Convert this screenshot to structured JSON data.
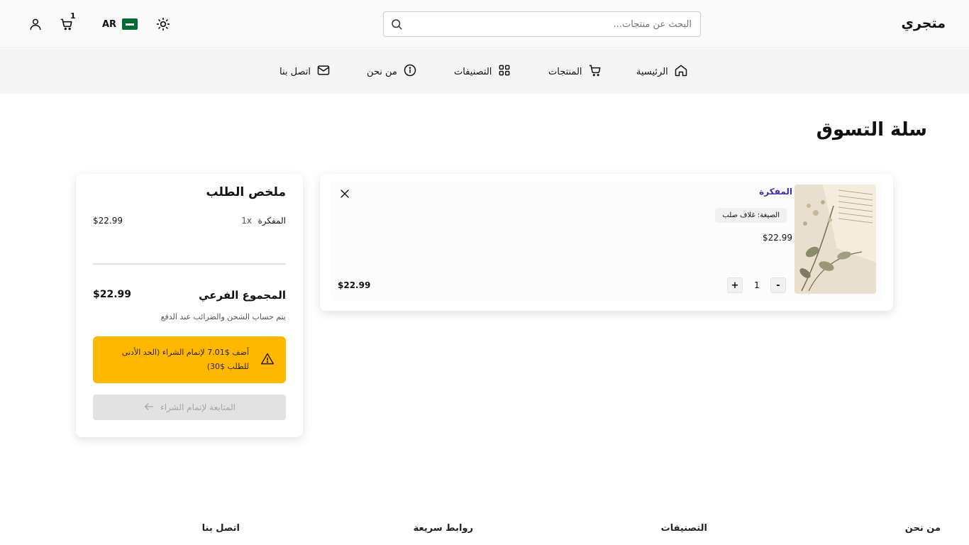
{
  "header": {
    "brand": "متجري",
    "search_placeholder": "البحث عن منتجات...",
    "lang": "AR",
    "cart_count": "1",
    "icons": {
      "search": "search-icon",
      "theme": "sun-icon",
      "cart": "cart-icon",
      "user": "user-icon",
      "flag": "saudi-flag-icon"
    }
  },
  "nav": {
    "home": "الرئيسية",
    "products": "المنتجات",
    "categories": "التصنيفات",
    "about": "من نحن",
    "contact": "اتصل بنا"
  },
  "page": {
    "title": "سلة التسوق"
  },
  "cart": {
    "items": [
      {
        "name": "المفكرة",
        "variant": "الصيغة: غلاف صلب",
        "unit_price": "$22.99",
        "quantity": "1",
        "line_total": "$22.99",
        "minus_label": "-",
        "plus_label": "+"
      }
    ]
  },
  "summary": {
    "title": "ملخص الطلب",
    "items": [
      {
        "name": "المفكرة",
        "qty": "1x",
        "price": "$22.99"
      }
    ],
    "subtotal_label": "المجموع الفرعي",
    "subtotal_value": "$22.99",
    "tax_note": "يتم حساب الشحن والضرائب عند الدفع",
    "warning": "أضف $7.01 لإتمام الشراء (الحد الأدنى للطلب $30)",
    "checkout_label": "المتابعة لإتمام الشراء"
  },
  "footer": {
    "about": "من نحن",
    "categories": "التصنيفات",
    "quick_links": "روابط سريعة",
    "contact": "اتصل بنا"
  },
  "colors": {
    "accent": "#3b2bbf",
    "warning": "#ffb800",
    "disabled": "#e2e2e2"
  }
}
